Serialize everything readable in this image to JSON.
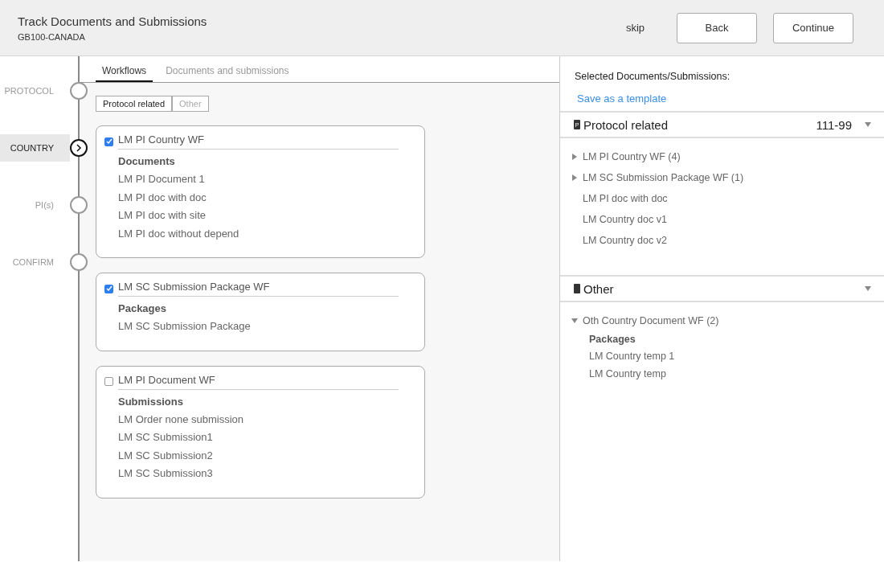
{
  "header": {
    "title": "Track Documents and Submissions",
    "subtitle": "GB100-CANADA",
    "skip": "skip",
    "buttons": [
      "Back",
      "Continue"
    ]
  },
  "steps": [
    {
      "label": "PROTOCOL",
      "selected": false
    },
    {
      "label": "COUNTRY",
      "selected": true
    },
    {
      "label": "PI(s)",
      "selected": false
    },
    {
      "label": "CONFIRM",
      "selected": false
    }
  ],
  "tabs": [
    {
      "label": "Workflows",
      "selected": true
    },
    {
      "label": "Documents and submissions",
      "selected": false
    }
  ],
  "filters": [
    {
      "label": "Protocol related",
      "selected": true
    },
    {
      "label": "Other",
      "selected": false
    }
  ],
  "workflows": [
    {
      "title": "LM PI Country WF",
      "checked": true,
      "heading": "Documents",
      "items": [
        "LM PI Document 1",
        "LM PI doc with doc",
        "LM PI doc with site",
        "LM PI doc without depend"
      ]
    },
    {
      "title": "LM SC Submission Package WF",
      "checked": true,
      "heading": "Packages",
      "items": [
        "LM SC Submission Package"
      ]
    },
    {
      "title": "LM PI Document WF",
      "checked": false,
      "heading": "Submissions",
      "items": [
        "LM Order none submission",
        "LM SC Submission1",
        "LM SC Submission2",
        "LM SC Submission3"
      ]
    }
  ],
  "selected_panel": {
    "title": "Selected Documents/Submissions:",
    "link": "Save as a template",
    "sections": [
      {
        "title": "Protocol related",
        "badge": "P",
        "code": "111-99",
        "items": [
          {
            "kind": "group",
            "label": "LM PI Country WF (4)",
            "expanded": false
          },
          {
            "kind": "group",
            "label": "LM SC Submission Package WF (1)",
            "expanded": false
          },
          {
            "kind": "doc",
            "label": "LM PI doc with doc"
          },
          {
            "kind": "doc",
            "label": "LM Country doc v1"
          },
          {
            "kind": "doc",
            "label": "LM Country doc v2"
          }
        ]
      },
      {
        "title": "Other",
        "items": [
          {
            "kind": "group",
            "label": "Oth Country Document WF (2)",
            "expanded": true,
            "heading": "Packages",
            "children": [
              "LM Country temp 1",
              "LM Country temp"
            ]
          }
        ]
      }
    ]
  }
}
